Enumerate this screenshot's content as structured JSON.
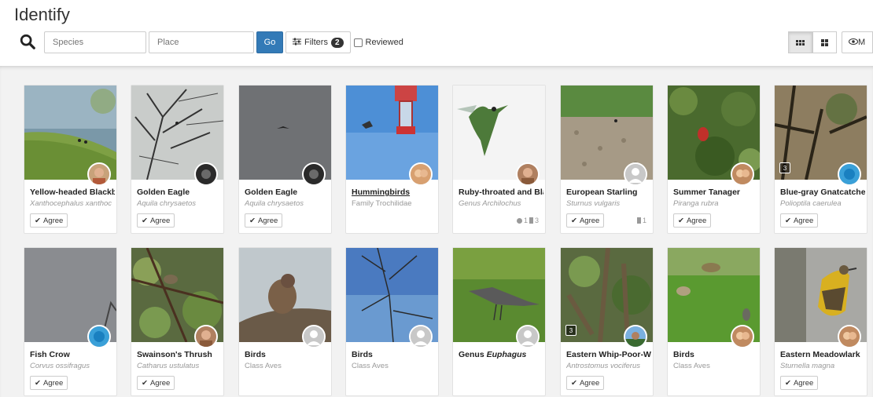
{
  "page": {
    "title": "Identify"
  },
  "search": {
    "species_placeholder": "Species",
    "place_placeholder": "Place",
    "go_label": "Go",
    "filters_label": "Filters",
    "filters_count": "2",
    "reviewed_label": "Reviewed"
  },
  "view_buttons": {
    "more_label": "M"
  },
  "agree_label": "Agree",
  "cards": [
    {
      "name": "Yellow-headed Blackbi",
      "sci": "Xanthocephalus xanthoc",
      "agree": true
    },
    {
      "name": "Golden Eagle",
      "sci": "Aquila chrysaetos",
      "agree": true
    },
    {
      "name": "Golden Eagle",
      "sci": "Aquila chrysaetos",
      "agree": true
    },
    {
      "name": "Hummingbirds",
      "sci": "Family Trochilidae",
      "agree": false
    },
    {
      "name": "Ruby-throated and Bla",
      "sci": "Genus Archilochus",
      "agree": false,
      "comments": "1",
      "ids": "3"
    },
    {
      "name": "European Starling",
      "sci": "Sturnus vulgaris",
      "agree": true,
      "ids": "1"
    },
    {
      "name": "Summer Tanager",
      "sci": "Piranga rubra",
      "agree": true
    },
    {
      "name": "Blue-gray Gnatcatcher",
      "sci": "Polioptila caerulea",
      "agree": true,
      "photos": "3"
    },
    {
      "name": "Fish Crow",
      "sci": "Corvus ossifragus",
      "agree": true
    },
    {
      "name": "Swainson's Thrush",
      "sci": "Catharus ustulatus",
      "agree": true
    },
    {
      "name": "Birds",
      "sci": "Class Aves",
      "agree": false
    },
    {
      "name": "Birds",
      "sci": "Class Aves",
      "agree": false
    },
    {
      "name": "Genus",
      "name_italic": "Euphagus",
      "sci": "",
      "agree": false
    },
    {
      "name": "Eastern Whip-Poor-Wi",
      "sci": "Antrostomus vociferus",
      "agree": true,
      "photos": "3"
    },
    {
      "name": "Birds",
      "sci": "Class Aves",
      "agree": false
    },
    {
      "name": "Eastern Meadowlark",
      "sci": "Sturnella magna",
      "agree": true
    }
  ],
  "colors": {
    "go_blue": "#337ab7",
    "stage_bg": "#f2f2f2"
  }
}
